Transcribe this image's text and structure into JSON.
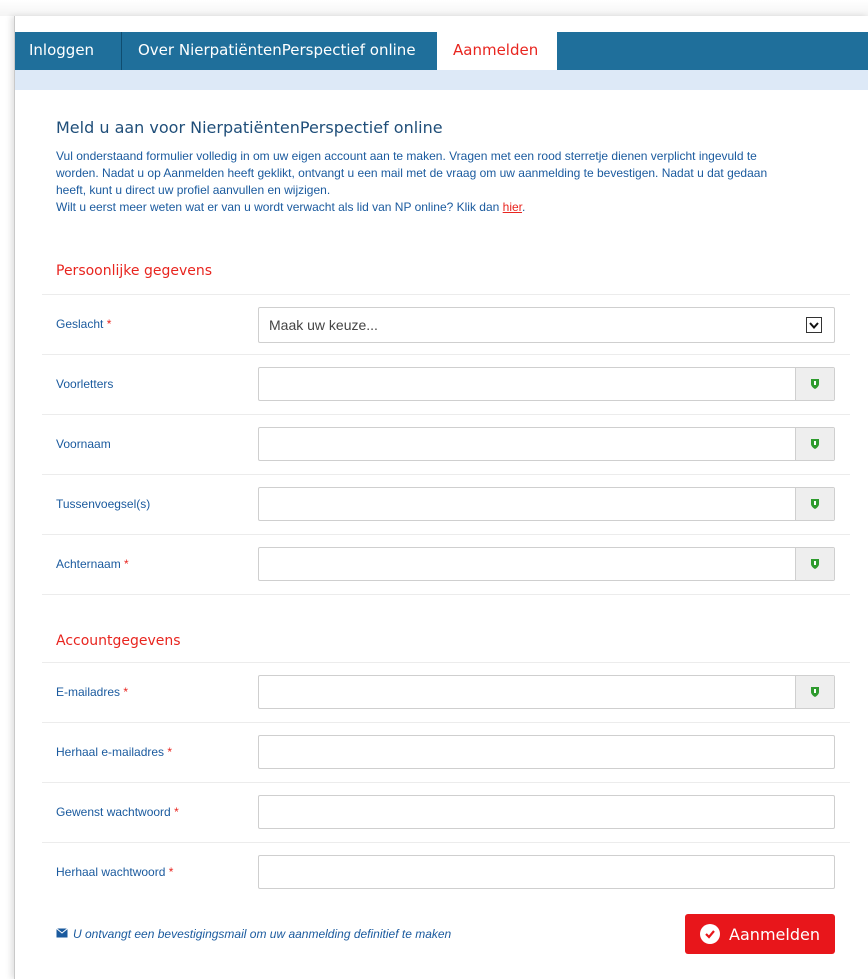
{
  "nav": {
    "tabs": [
      {
        "label": "Inloggen"
      },
      {
        "label": "Over NierpatiëntenPerspectief online"
      },
      {
        "label": "Aanmelden"
      }
    ]
  },
  "page": {
    "title": "Meld u aan voor NierpatiëntenPerspectief online",
    "intro_lines": [
      "Vul onderstaand formulier volledig in om uw eigen account aan te maken. Vragen met een rood sterretje dienen verplicht ingevuld te",
      "worden. Nadat u op Aanmelden heeft geklikt, ontvangt u een mail met de vraag om uw aanmelding te bevestigen. Nadat u dat gedaan",
      "heeft, kunt u direct uw profiel aanvullen en wijzigen."
    ],
    "intro_link_prefix": "Wilt u eerst meer weten wat er van u wordt verwacht als lid van NP online? Klik dan ",
    "intro_link_text": "hier",
    "intro_link_suffix": "."
  },
  "sections": {
    "personal": "Persoonlijke gegevens",
    "account": "Accountgegevens"
  },
  "fields": {
    "gender_label": "Geslacht",
    "gender_placeholder": "Maak uw keuze...",
    "initials_label": "Voorletters",
    "firstname_label": "Voornaam",
    "infix_label": "Tussenvoegsel(s)",
    "lastname_label": "Achternaam",
    "email_label": "E-mailadres",
    "email_repeat_label": "Herhaal e-mailadres",
    "password_label": "Gewenst wachtwoord",
    "password_repeat_label": "Herhaal wachtwoord",
    "required_marker": "*"
  },
  "footer": {
    "note": "U ontvangt een bevestigingsmail om uw aanmelding definitief te maken",
    "submit_label": "Aanmelden"
  },
  "colors": {
    "nav_bg": "#1f6f9b",
    "accent_red": "#e8251f",
    "label_blue": "#1a5a9e",
    "shield_green": "#2e9b2e"
  },
  "icons": {
    "field_addon": "shield-icon",
    "note": "envelope-icon",
    "submit": "check-circle-icon",
    "select": "chevron-down-icon"
  }
}
